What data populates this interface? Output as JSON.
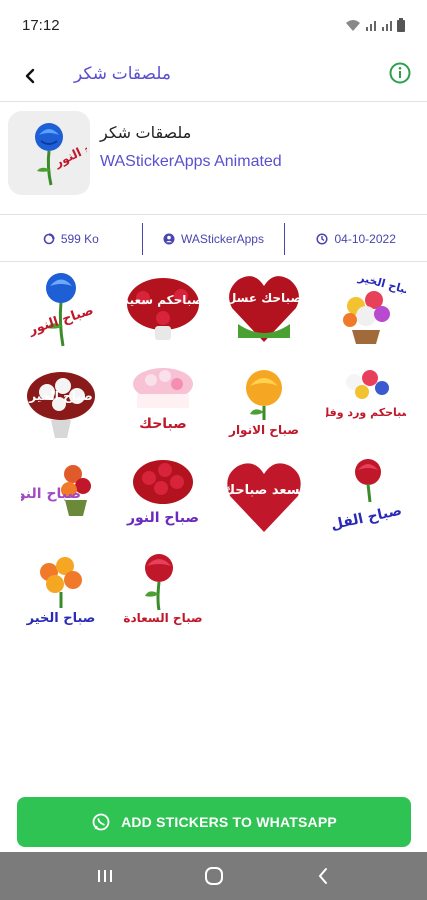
{
  "status_bar": {
    "time": "17:12"
  },
  "app_bar": {
    "title": "ملصقات شكر"
  },
  "pack": {
    "name": "ملصقات شكر",
    "publisher": "WAStickerApps Animated",
    "icon_caption": "صباح النور"
  },
  "meta": {
    "size": "599 Ko",
    "author": "WAStickerApps",
    "date": "04-10-2022"
  },
  "stickers": [
    {
      "caption": "صباح النور",
      "color": "#c0182a"
    },
    {
      "caption": "صباحكم سعيد",
      "color": "#ffffff"
    },
    {
      "caption": "صباحك عسل",
      "color": "#ffffff"
    },
    {
      "caption": "صباح الخير",
      "color": "#2a2ab8"
    },
    {
      "caption": "صباح الخير",
      "color": "#ffffff"
    },
    {
      "caption": "صباحك",
      "color": "#c0182a"
    },
    {
      "caption": "صباح الانوار",
      "color": "#c0182a"
    },
    {
      "caption": "صباحكم ورد وفل",
      "color": "#c0182a"
    },
    {
      "caption": "صباح النور",
      "color": "#a24ac0"
    },
    {
      "caption": "صباح النور",
      "color": "#6a2ac0"
    },
    {
      "caption": "يسعد صباحك",
      "color": "#ffffff"
    },
    {
      "caption": "صباح الفل",
      "color": "#2a2ab8"
    },
    {
      "caption": "صباح الخير",
      "color": "#2a2ab8"
    },
    {
      "caption": "صباح السعادة",
      "color": "#c0182a"
    }
  ],
  "add_button": {
    "label": "ADD STICKERS TO WHATSAPP"
  },
  "colors": {
    "accent": "#5a4fcf",
    "button": "#2fc354",
    "info": "#2e9e4f"
  }
}
